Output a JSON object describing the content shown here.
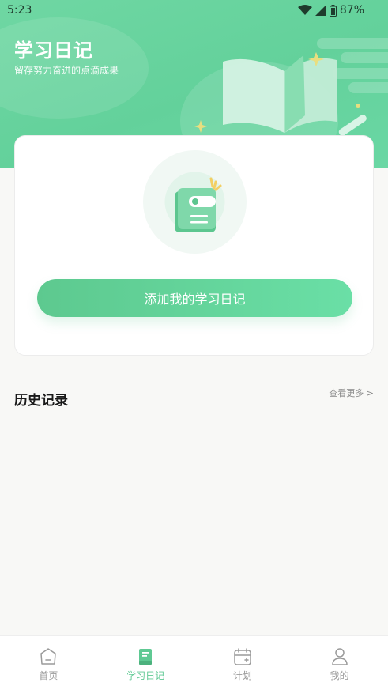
{
  "status_bar": {
    "time": "5:23",
    "battery": "87%"
  },
  "hero": {
    "title": "学习日记",
    "subtitle": "留存努力奋进的点滴成果"
  },
  "card": {
    "add_button_label": "添加我的学习日记"
  },
  "history": {
    "title": "历史记录",
    "more_label": "查看更多 >"
  },
  "tabbar": {
    "tabs": [
      {
        "label": "首页",
        "icon": "home-icon",
        "active": false
      },
      {
        "label": "学习日记",
        "icon": "diary-icon",
        "active": true
      },
      {
        "label": "计划",
        "icon": "calendar-icon",
        "active": false
      },
      {
        "label": "我的",
        "icon": "user-icon",
        "active": false
      }
    ]
  },
  "colors": {
    "brand": "#63d19b",
    "active_tab": "#5fc993",
    "inactive_tab": "#9a9a9a"
  }
}
